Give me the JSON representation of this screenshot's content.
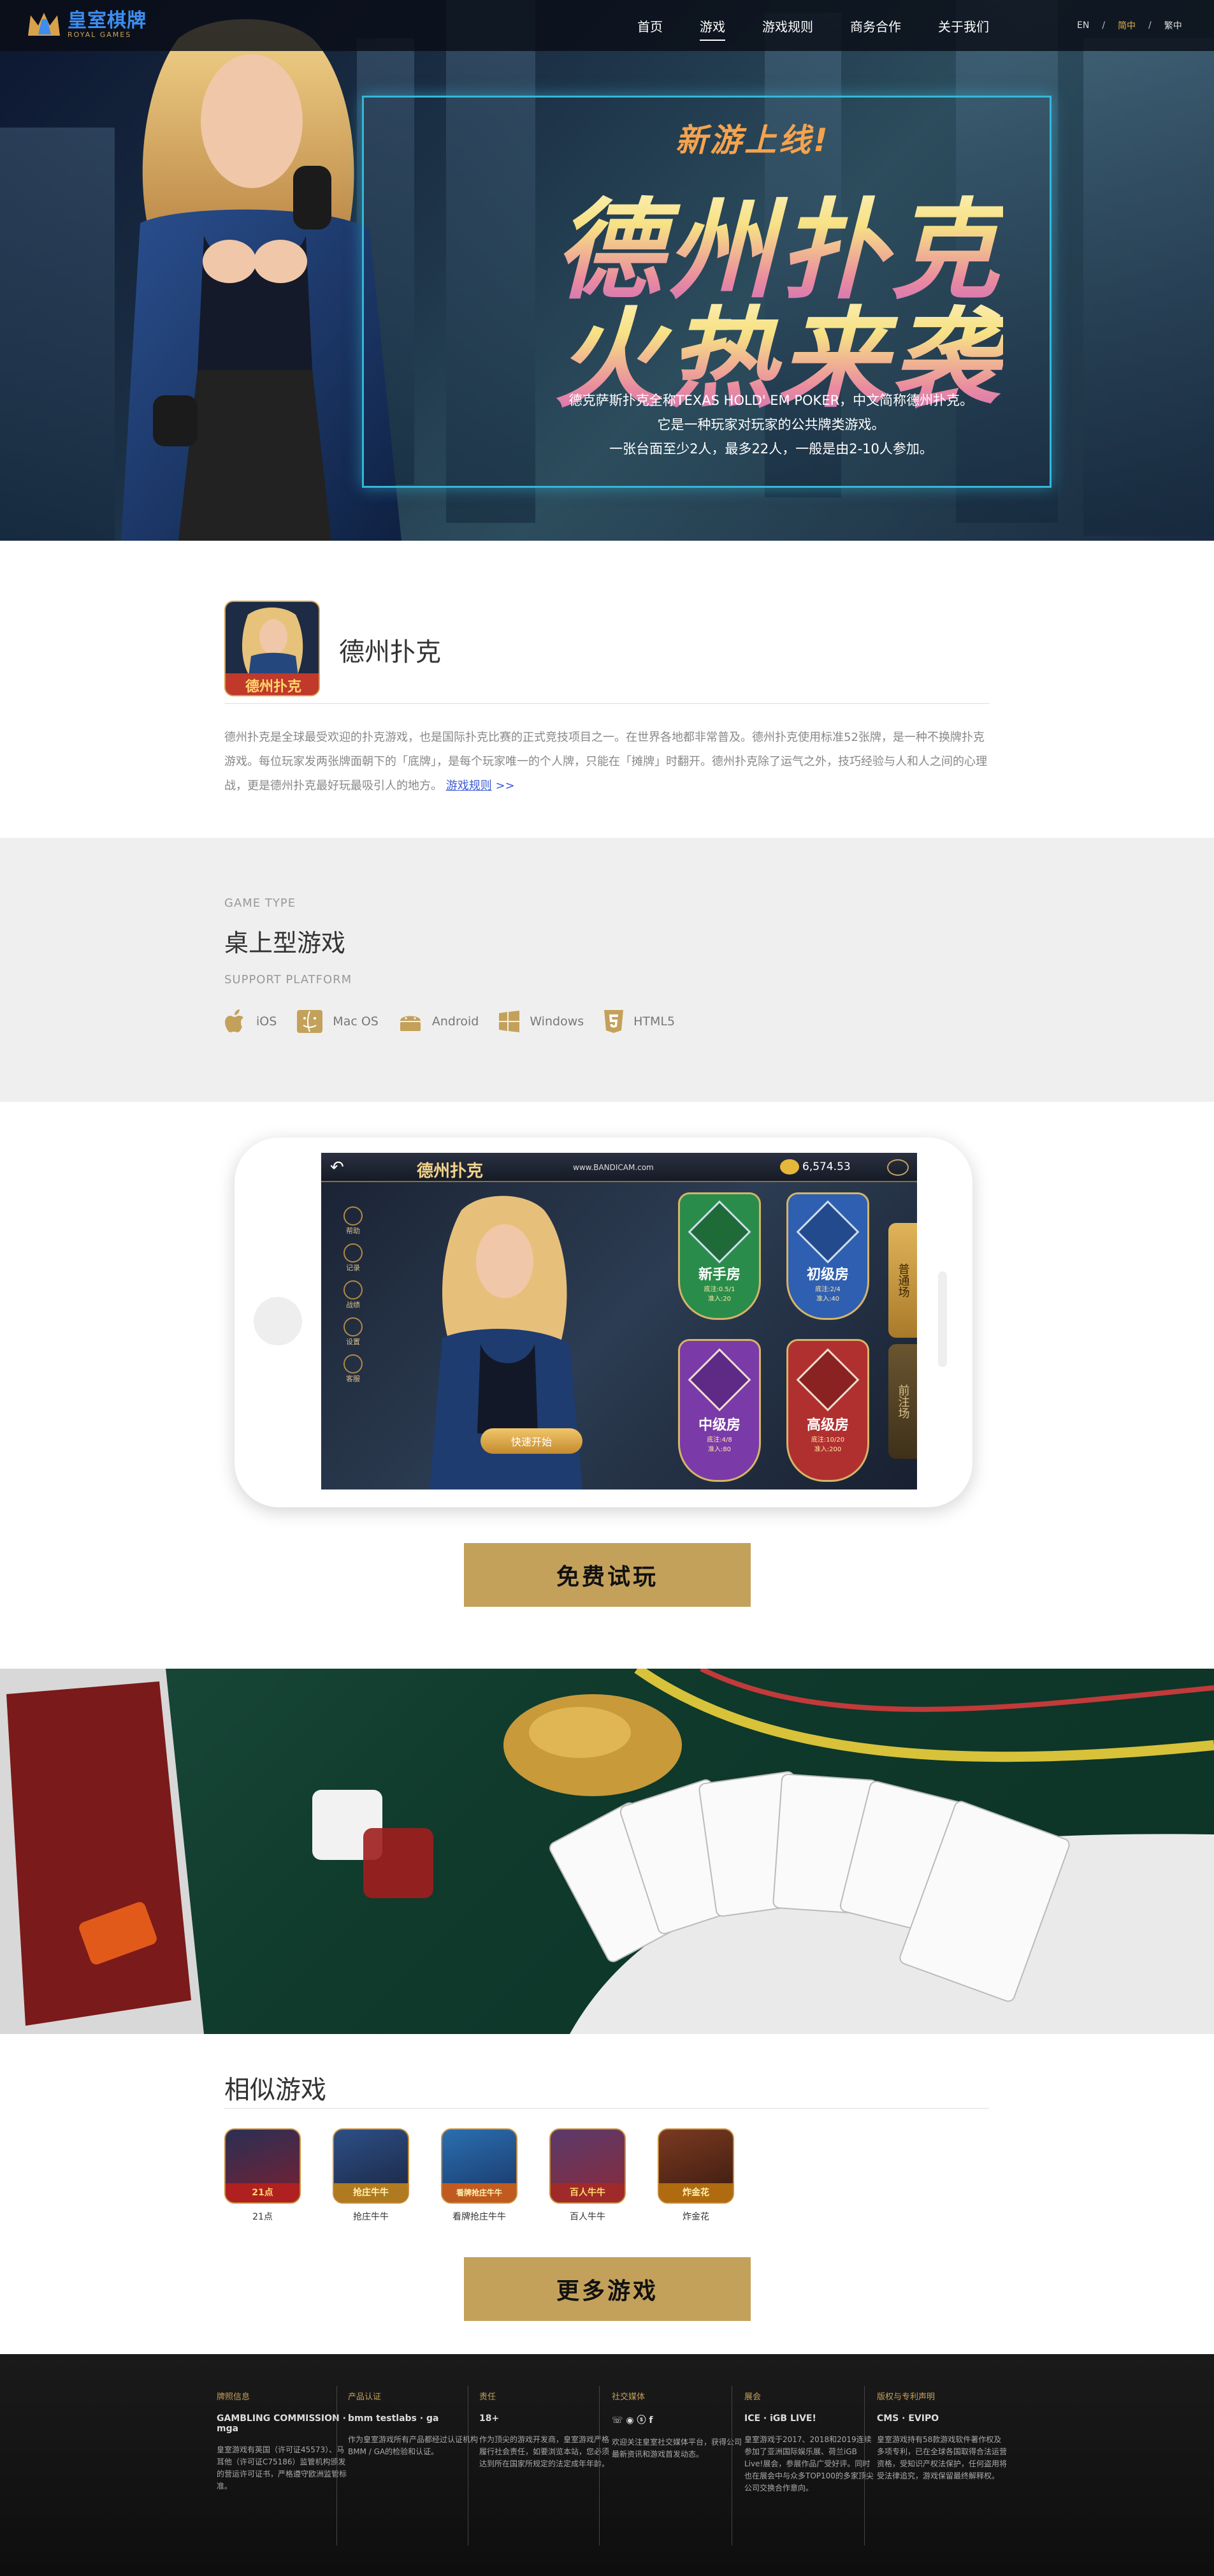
{
  "header": {
    "logo_cn": "皇室棋牌",
    "logo_en": "ROYAL GAMES",
    "nav": [
      "首页",
      "游戏",
      "游戏规则",
      "商务合作",
      "关于我们"
    ],
    "active_nav": "游戏",
    "langs": [
      "EN",
      "简中",
      "繁中"
    ],
    "active_lang": "简中",
    "accent": "#e8b04a"
  },
  "hero": {
    "subtitle": "新游上线!",
    "title_line1": "德州扑克",
    "title_line2": "火热来袭",
    "desc_lines": [
      "德克萨斯扑克全称TEXAS HOLD' EM POKER，中文简称德州扑克。",
      "它是一种玩家对玩家的公共牌类游戏。",
      "一张台面至少2人，最多22人，一般是由2-10人参加。"
    ],
    "frame_color": "#35b7d8"
  },
  "game": {
    "icon_text": "德州扑克",
    "name": "德州扑克",
    "description": "德州扑克是全球最受欢迎的扑克游戏，也是国际扑克比赛的正式竞技项目之一。在世界各地都非常普及。德州扑克使用标准52张牌，是一种不换牌扑克游戏。每位玩家发两张牌面朝下的「底牌」，是每个玩家唯一的个人牌，只能在「摊牌」时翻开。德州扑克除了运气之外，技巧经验与人和人之间的心理战，更是德州扑克最好玩最吸引人的地方。",
    "rules_link": "游戏规则",
    "rules_arrow": ">>"
  },
  "type_section": {
    "game_type_label": "GAME TYPE",
    "game_type": "桌上型游戏",
    "platform_label": "SUPPORT PLATFORM",
    "platforms": [
      {
        "name": "iOS",
        "icon": "apple-icon"
      },
      {
        "name": "Mac OS",
        "icon": "mac-finder-icon"
      },
      {
        "name": "Android",
        "icon": "android-icon"
      },
      {
        "name": "Windows",
        "icon": "windows-icon"
      },
      {
        "name": "HTML5",
        "icon": "html5-icon"
      }
    ]
  },
  "screenshot": {
    "title": "德州扑克",
    "watermark": "www.BANDICAM.com",
    "coins": "6,574.53",
    "side_menu": [
      "帮助",
      "记录",
      "战绩",
      "设置",
      "客服"
    ],
    "rooms": [
      {
        "name": "新手房",
        "line1": "底注:0.5/1",
        "line2": "准入:20",
        "color": "#2a8c4a"
      },
      {
        "name": "初级房",
        "line1": "底注:2/4",
        "line2": "准入:40",
        "color": "#2f5fb0"
      },
      {
        "name": "中级房",
        "line1": "底注:4/8",
        "line2": "准入:80",
        "color": "#7a3aa8"
      },
      {
        "name": "高级房",
        "line1": "底注:10/20",
        "line2": "准入:200",
        "color": "#b03030"
      }
    ],
    "quick_start": "快速开始",
    "tab_normal": "普通场",
    "tab_ante": "前注场"
  },
  "buttons": {
    "trial": "免费试玩",
    "more": "更多游戏",
    "color": "#c4a15a"
  },
  "similar": {
    "title": "相似游戏",
    "games": [
      {
        "label": "21点",
        "badge": "21点"
      },
      {
        "label": "抢庄牛牛",
        "badge": "抢庄牛牛"
      },
      {
        "label": "看牌抢庄牛牛",
        "badge": "看牌抢庄牛牛"
      },
      {
        "label": "百人牛牛",
        "badge": "百人牛牛"
      },
      {
        "label": "炸金花",
        "badge": "炸金花"
      }
    ]
  },
  "footer": {
    "cols": [
      {
        "title": "牌照信息",
        "logo": "GAMBLING COMMISSION · mga",
        "text": "皇室游戏有英国（许可证45573）、马耳他（许可证C75186）监管机构颁发的营运许可证书，严格遵守欧洲监管标准。"
      },
      {
        "title": "产品认证",
        "logo": "bmm testlabs · ga",
        "text": "作为皇室游戏所有产品都经过认证机构BMM / GA的检验和认证。"
      },
      {
        "title": "责任",
        "logo": "18+",
        "text": "作为顶尖的游戏开发商，皇室游戏严格履行社会责任，如要浏览本站，您必须达到所在国家所规定的法定成年年龄。"
      },
      {
        "title": "社交媒体",
        "logo": "☏ ◉ ⓢ f",
        "text": "欢迎关注皇室社交媒体平台，获得公司最新资讯和游戏首发动态。"
      },
      {
        "title": "展会",
        "logo": "ICE · iGB LIVE!",
        "text": "皇室游戏于2017、2018和2019连续参加了亚洲国际娱乐展、荷兰iGB Live!展会，参展作品广受好评。同时也在展会中与众多TOP100的多家顶尖公司交换合作意向。"
      },
      {
        "title": "版权与专利声明",
        "logo": "CMS · EVIPO",
        "text": "皇室游戏持有58款游戏软件著作权及多项专利，已在全球各国取得合法运营资格，受知识产权法保护，任何盗用将受法律追究，游戏保留最终解释权。"
      }
    ]
  }
}
